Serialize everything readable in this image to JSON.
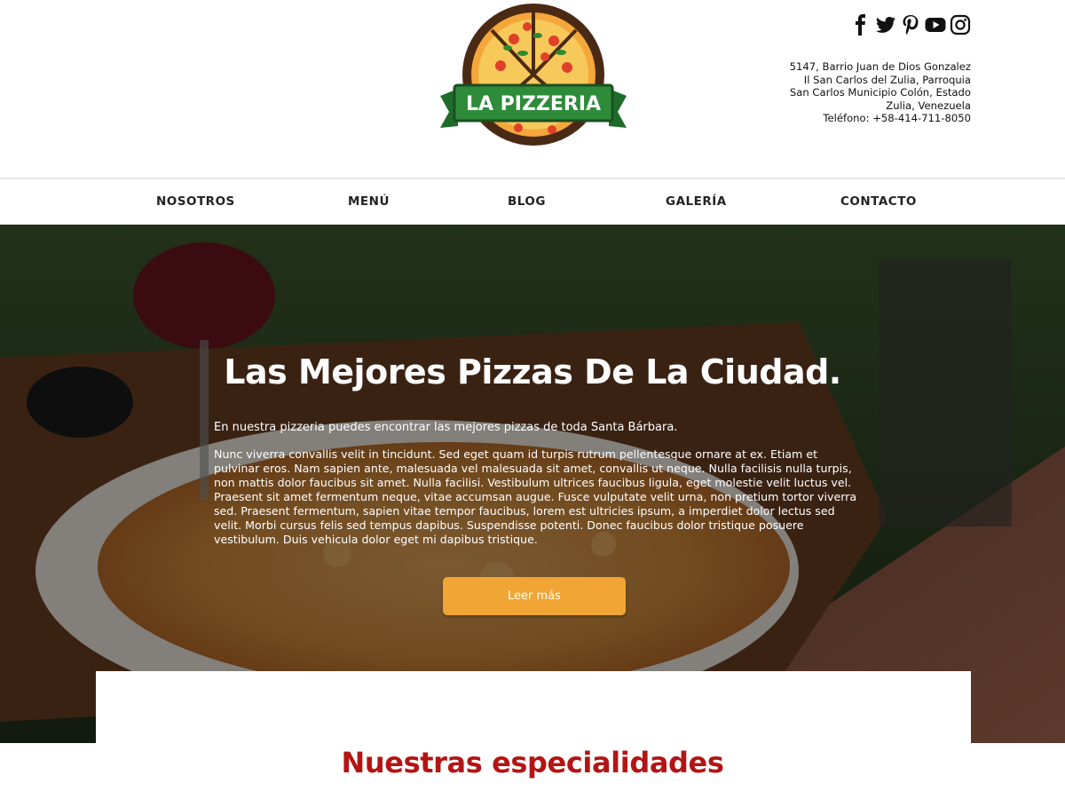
{
  "brand": {
    "logo_text": "LA PIZZERIA"
  },
  "social": {
    "icons": [
      "facebook-icon",
      "twitter-icon",
      "pinterest-icon",
      "youtube-icon",
      "instagram-icon"
    ]
  },
  "address": {
    "line1": "5147, Barrio Juan de Dios Gonzalez",
    "line2": "Il San Carlos del Zulia, Parroquia",
    "line3": "San Carlos Municipio Colón, Estado",
    "line4": "Zulia, Venezuela",
    "phone": "Teléfono: +58-414-711-8050"
  },
  "nav": {
    "items": [
      {
        "label": "NOSOTROS"
      },
      {
        "label": "MENÚ"
      },
      {
        "label": "BLOG"
      },
      {
        "label": "GALERÍA"
      },
      {
        "label": "CONTACTO"
      }
    ]
  },
  "hero": {
    "title": "Las Mejores Pizzas De La Ciudad.",
    "intro": "En nuestra pizzeria puedes encontrar las mejores pizzas de toda Santa Bárbara.",
    "body": "Nunc viverra convallis velit in tincidunt. Sed eget quam id turpis rutrum pellentesque ornare at ex. Etiam et pulvinar eros. Nam sapien ante, malesuada vel malesuada sit amet, convallis ut neque. Nulla facilisis nulla turpis, non mattis dolor faucibus sit amet. Nulla facilisi. Vestibulum ultrices faucibus ligula, eget molestie velit luctus vel. Praesent sit amet fermentum neque, vitae accumsan augue. Fusce vulputate velit urna, non pretium tortor viverra sed. Praesent fermentum, sapien vitae tempor faucibus, lorem est ultricies ipsum, a imperdiet dolor lectus sed velit. Morbi cursus felis sed tempus dapibus. Suspendisse potenti. Donec faucibus dolor tristique posuere vestibulum. Duis vehicula dolor eget mi dapibus tristique.",
    "button_label": "Leer más"
  },
  "specialties": {
    "title": "Nuestras especialidades"
  },
  "colors": {
    "accent_button": "#f0a535",
    "section_title": "#b41414",
    "logo_banner": "#2e8b3a"
  }
}
